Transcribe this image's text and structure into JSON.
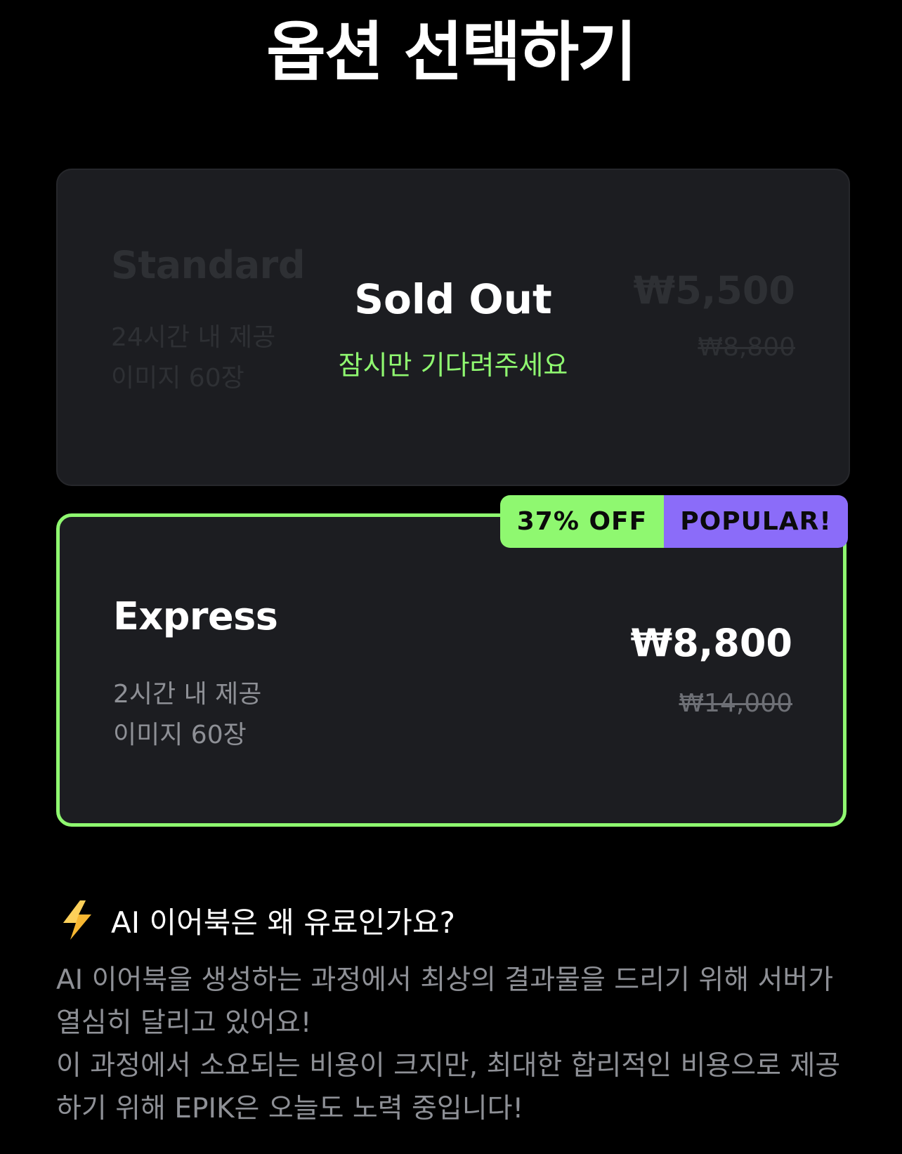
{
  "title": "옵션 선택하기",
  "options": [
    {
      "name": "Standard",
      "detail_lines": [
        "24시간 내 제공",
        "이미지 60장"
      ],
      "price": "₩5,500",
      "original_price": "₩8,800",
      "status": "Sold Out",
      "status_sub": "잠시만 기다려주세요"
    },
    {
      "name": "Express",
      "detail_lines": [
        "2시간 내 제공",
        "이미지 60장"
      ],
      "price": "₩8,800",
      "original_price": "₩14,000",
      "badges": [
        "37% OFF",
        "POPULAR!"
      ]
    }
  ],
  "faq": {
    "icon": "lightning-bolt-icon",
    "question": "AI 이어북은 왜 유료인가요?",
    "answer_lines": [
      "AI 이어북을 생성하는 과정에서 최상의 결과물을 드리기 위해 서버가 열심히 달리고 있어요!",
      "이 과정에서 소요되는 비용이 크지만, 최대한 합리적인 비용으로 제공하기 위해 EPIK은 오늘도 노력 중입니다!"
    ]
  },
  "colors": {
    "background": "#000000",
    "card": "#1c1d21",
    "accent_green": "#8ff870",
    "accent_purple": "#8b6cf9",
    "muted_text": "#8e9096"
  }
}
